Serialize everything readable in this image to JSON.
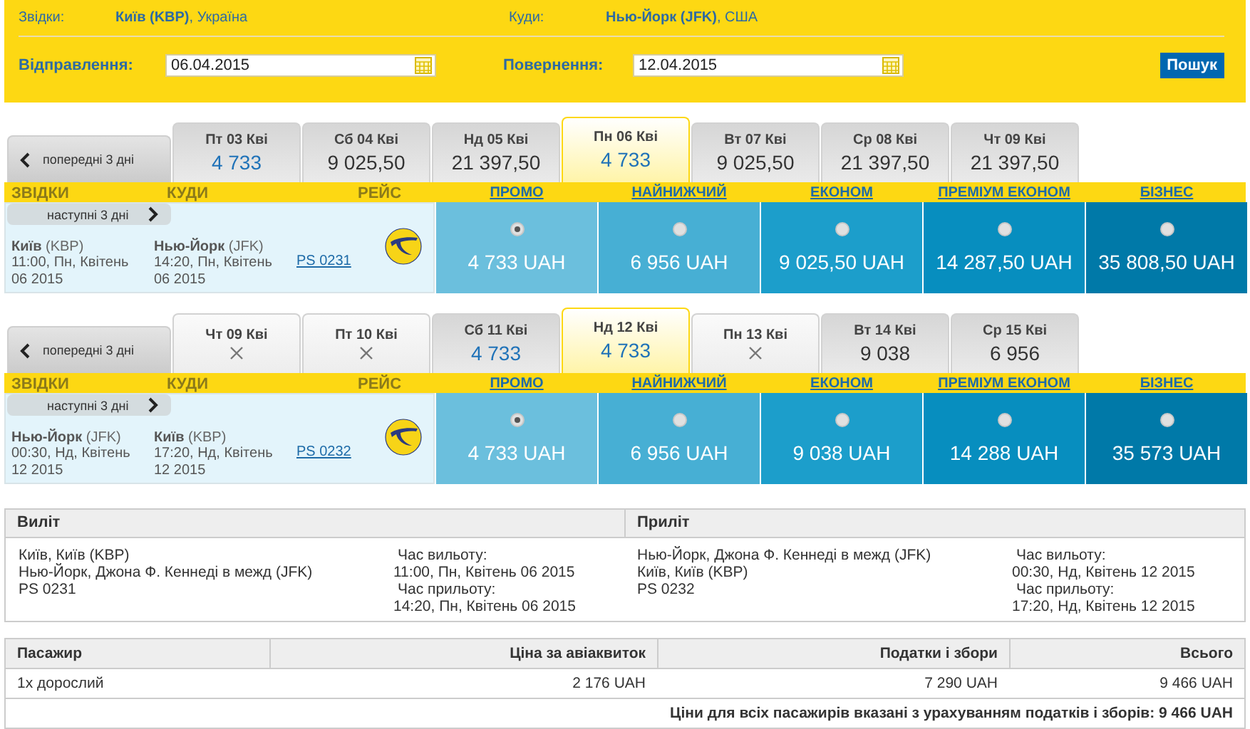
{
  "search": {
    "from_label": "Звідки:",
    "from_value": "**Київ (KBP)**, Україна",
    "to_label": "Куди:",
    "to_value": "**Нью-Йорк (JFK)**, США",
    "depart_label": "Відправлення:",
    "depart_value": "06.04.2015",
    "return_label": "Повернення:",
    "return_value": "12.04.2015",
    "button": "Пошук"
  },
  "flights": [
    {
      "prev": "попередні 3 дні",
      "next": "наступні 3 дні",
      "dates": [
        {
          "day": "Пт 03 Кві",
          "price": "4 733",
          "available": true,
          "lowest": true,
          "selected": false
        },
        {
          "day": "Сб 04 Кві",
          "price": "9 025,50",
          "available": true,
          "lowest": false,
          "selected": false
        },
        {
          "day": "Нд 05 Кві",
          "price": "21 397,50",
          "available": true,
          "lowest": false,
          "selected": false
        },
        {
          "day": "Пн 06 Кві",
          "price": "4 733",
          "available": true,
          "lowest": true,
          "selected": true
        },
        {
          "day": "Вт 07 Кві",
          "price": "9 025,50",
          "available": true,
          "lowest": false,
          "selected": false
        },
        {
          "day": "Ср 08 Кві",
          "price": "21 397,50",
          "available": true,
          "lowest": false,
          "selected": false
        },
        {
          "day": "Чт 09 Кві",
          "price": "21 397,50",
          "available": true,
          "lowest": false,
          "selected": false
        }
      ],
      "columns": [
        "ЗВІДКИ",
        "КУДИ",
        "РЕЙС"
      ],
      "from": {
        "place": "**Київ** (KBP)",
        "time": "11:00, Пн, Квітень 06 2015"
      },
      "to": {
        "place": "**Нью-Йорк** (JFK)",
        "time": "14:20, Пн, Квітень 06 2015"
      },
      "flight": "PS 0231",
      "fares": [
        {
          "label": "ПРОМО",
          "price": "4 733 UAH",
          "selected": true,
          "color": "#6bbfdd"
        },
        {
          "label": "НАЙНИЖЧИЙ",
          "price": "6 956 UAH",
          "selected": false,
          "color": "#47afd4"
        },
        {
          "label": "ЕКОНОМ",
          "price": "9 025,50 UAH",
          "selected": false,
          "color": "#1c9ecb"
        },
        {
          "label": "ПРЕМІУМ ЕКОНОМ",
          "price": "14 287,50 UAH",
          "selected": false,
          "color": "#078ebf"
        },
        {
          "label": "БІЗНЕС",
          "price": "35 808,50 UAH",
          "selected": false,
          "color": "#0079a8"
        }
      ]
    },
    {
      "prev": "попередні 3 дні",
      "next": "наступні 3 дні",
      "dates": [
        {
          "day": "Чт 09 Кві",
          "available": false,
          "selected": false
        },
        {
          "day": "Пт 10 Кві",
          "available": false,
          "selected": false
        },
        {
          "day": "Сб 11 Кві",
          "price": "4 733",
          "available": true,
          "lowest": true,
          "selected": false
        },
        {
          "day": "Нд 12 Кві",
          "price": "4 733",
          "available": true,
          "lowest": true,
          "selected": true
        },
        {
          "day": "Пн 13 Кві",
          "available": false,
          "selected": false
        },
        {
          "day": "Вт 14 Кві",
          "price": "9 038",
          "available": true,
          "lowest": false,
          "selected": false
        },
        {
          "day": "Ср 15 Кві",
          "price": "6 956",
          "available": true,
          "lowest": false,
          "selected": false
        }
      ],
      "columns": [
        "ЗВІДКИ",
        "КУДИ",
        "РЕЙС"
      ],
      "from": {
        "place": "**Нью-Йорк** (JFK)",
        "time": "00:30, Нд, Квітень 12 2015"
      },
      "to": {
        "place": "**Київ** (KBP)",
        "time": "17:20, Нд, Квітень 12 2015"
      },
      "flight": "PS 0232",
      "fares": [
        {
          "label": "ПРОМО",
          "price": "4 733 UAH",
          "selected": true,
          "color": "#6bbfdd"
        },
        {
          "label": "НАЙНИЖЧИЙ",
          "price": "6 956 UAH",
          "selected": false,
          "color": "#47afd4"
        },
        {
          "label": "ЕКОНОМ",
          "price": "9 038 UAH",
          "selected": false,
          "color": "#1c9ecb"
        },
        {
          "label": "ПРЕМІУМ ЕКОНОМ",
          "price": "14 288 UAH",
          "selected": false,
          "color": "#078ebf"
        },
        {
          "label": "БІЗНЕС",
          "price": "35 573 UAH",
          "selected": false,
          "color": "#0079a8"
        }
      ]
    }
  ],
  "details": [
    {
      "heading": "Виліт",
      "lines": [
        "Київ, Київ (KBP)",
        "Нью-Йорк, Джона Ф. Кеннеді в межд (JFK)",
        "PS 0231"
      ],
      "times": [
        {
          "label": "Час вильоту:",
          "value": "11:00, Пн, Квітень 06 2015"
        },
        {
          "label": "Час прильоту:",
          "value": "14:20, Пн, Квітень 06 2015"
        }
      ]
    },
    {
      "heading": "Приліт",
      "lines": [
        "Нью-Йорк, Джона Ф. Кеннеді в межд (JFK)",
        "Київ, Київ (KBP)",
        "PS 0232"
      ],
      "times": [
        {
          "label": "Час вильоту:",
          "value": "00:30, Нд, Квітень 12 2015"
        },
        {
          "label": "Час прильоту:",
          "value": "17:20, Нд, Квітень 12 2015"
        }
      ]
    }
  ],
  "prices": {
    "columns": [
      "Пасажир",
      "Ціна за авіаквиток",
      "Податки і збори",
      "Всього"
    ],
    "rows": [
      [
        "1x дорослий",
        "2 176 UAH",
        "7 290 UAH",
        "9 466 UAH"
      ]
    ],
    "total": "Ціни для всіх пасажирів вказані з урахуванням податків і зборів: 9 466 UAH"
  }
}
